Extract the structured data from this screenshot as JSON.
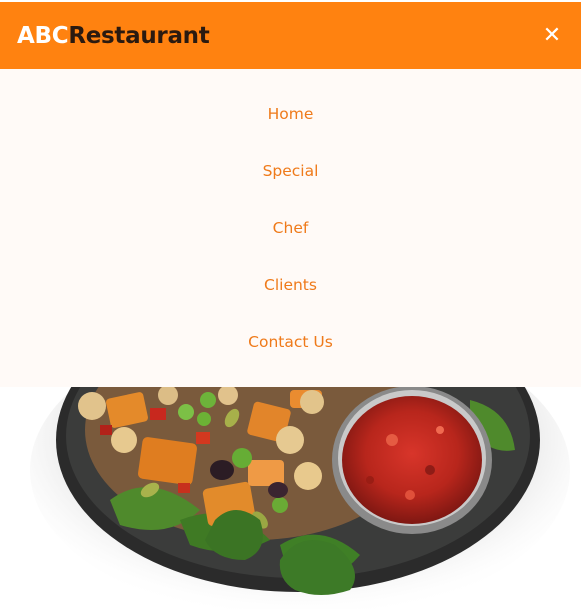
{
  "header": {
    "brand_part1": "ABC",
    "brand_part2": "Restaurant",
    "close_icon": "close-icon",
    "close_glyph": "✕",
    "background_color": "#ff8210"
  },
  "nav": {
    "items": [
      {
        "label": "Home"
      },
      {
        "label": "Special"
      },
      {
        "label": "Chef"
      },
      {
        "label": "Clients"
      },
      {
        "label": "Contact Us"
      }
    ],
    "text_color": "#ef7a1a",
    "background_color": "#fffaf7"
  },
  "hero": {
    "image": "salad-bowl-with-salsa"
  }
}
